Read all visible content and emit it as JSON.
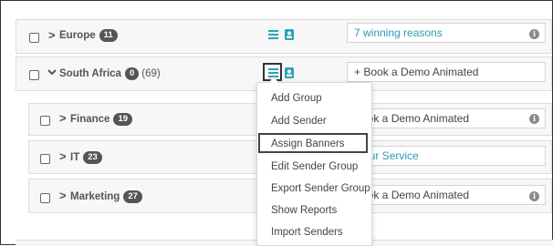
{
  "groups": [
    {
      "name": "Europe",
      "count": "11",
      "total": "",
      "banner": "7 winning reasons",
      "banner_style": "link",
      "info": true
    },
    {
      "name": "South Africa",
      "count": "0",
      "total": "(69)",
      "banner": "+ Book a Demo Animated",
      "banner_style": "dark",
      "info": false
    },
    {
      "name": "Finance",
      "count": "19",
      "total": "",
      "banner": "Book a Demo Animated",
      "banner_style": "dark",
      "info": true
    },
    {
      "name": "IT",
      "count": "23",
      "total": "",
      "banner": "e our Service",
      "banner_style": "link",
      "info": false
    },
    {
      "name": "Marketing",
      "count": "27",
      "total": "",
      "banner": "Book a Demo Animated",
      "banner_style": "dark",
      "info": true
    }
  ],
  "menu": {
    "items": [
      "Add Group",
      "Add Sender",
      "Assign Banners",
      "Edit Sender Group",
      "Export Sender Group",
      "Show Reports",
      "Import Senders"
    ]
  },
  "colors": {
    "link": "#2c9bb2",
    "icon_teal": "#2aa5b5",
    "badge": "#555555"
  },
  "icons": {
    "menu": "hamburger-menu-icon",
    "user": "user-card-icon",
    "info": "info-icon",
    "expand": "chevron-right-icon",
    "collapse": "chevron-down-icon"
  }
}
